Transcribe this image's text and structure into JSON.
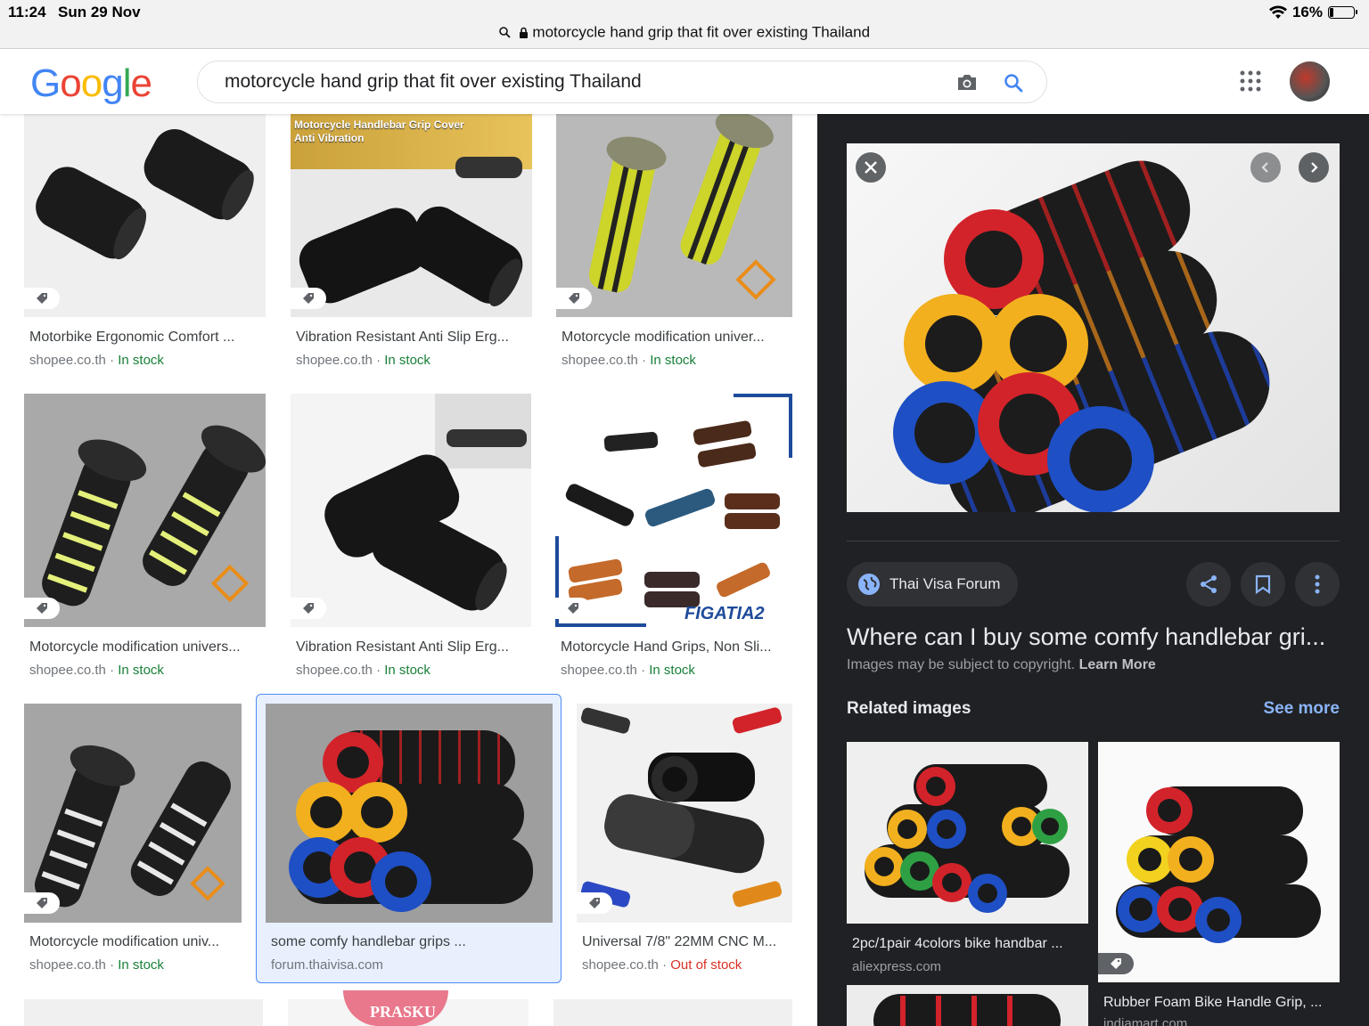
{
  "status": {
    "time": "11:24",
    "date": "Sun 29 Nov",
    "battery": "16%"
  },
  "browser": {
    "url_text": "motorcycle hand grip that fit over existing Thailand"
  },
  "header": {
    "logo": "Google",
    "query": "motorcycle hand grip that fit over existing Thailand"
  },
  "results": [
    {
      "title": "Motorbike Ergonomic Comfort ...",
      "source": "shopee.co.th",
      "sep": " · ",
      "stock": "In stock",
      "stock_status": "in"
    },
    {
      "title": "Vibration Resistant Anti Slip Erg...",
      "source": "shopee.co.th",
      "sep": " · ",
      "stock": "In stock",
      "stock_status": "in",
      "banner": "Motorcycle Handlebar Grip Cover\nAnti Vibration"
    },
    {
      "title": "Motorcycle modification univer...",
      "source": "shopee.co.th",
      "sep": " · ",
      "stock": "In stock",
      "stock_status": "in"
    },
    {
      "title": "Motorcycle modification univers...",
      "source": "shopee.co.th",
      "sep": " · ",
      "stock": "In stock",
      "stock_status": "in"
    },
    {
      "title": "Vibration Resistant Anti Slip Erg...",
      "source": "shopee.co.th",
      "sep": " · ",
      "stock": "In stock",
      "stock_status": "in"
    },
    {
      "title": "Motorcycle Hand Grips, Non Sli...",
      "source": "shopee.co.th",
      "sep": " · ",
      "stock": "In stock",
      "stock_status": "in",
      "brand": "FIGATIA2"
    },
    {
      "title": "Motorcycle modification univ...",
      "source": "shopee.co.th",
      "sep": " · ",
      "stock": "In stock",
      "stock_status": "in"
    },
    {
      "title": "some comfy handlebar grips ...",
      "source": "forum.thaivisa.com",
      "sep": "",
      "stock": "",
      "stock_status": "none"
    },
    {
      "title": "Universal 7/8\" 22MM CNC M...",
      "source": "shopee.co.th",
      "sep": " · ",
      "stock": "Out of stock",
      "stock_status": "out"
    }
  ],
  "partial_row": {
    "text": "PRASKU"
  },
  "panel": {
    "source_name": "Thai Visa Forum",
    "title": "Where can I buy some comfy handlebar gri...",
    "copyright": "Images may be subject to copyright.",
    "learn_more": "Learn More",
    "related_heading": "Related images",
    "see_more": "See more",
    "related": [
      {
        "title": "2pc/1pair 4colors bike handbar ...",
        "source": "aliexpress.com"
      },
      {
        "title": "Rubber Foam Bike Handle Grip, ...",
        "source": "indiamart.com"
      }
    ]
  },
  "colors": {
    "accent_blue": "#4285f4",
    "in_stock": "#188038",
    "out_of_stock": "#d93025",
    "panel_bg": "#202124",
    "link_blue": "#8ab4f8"
  }
}
